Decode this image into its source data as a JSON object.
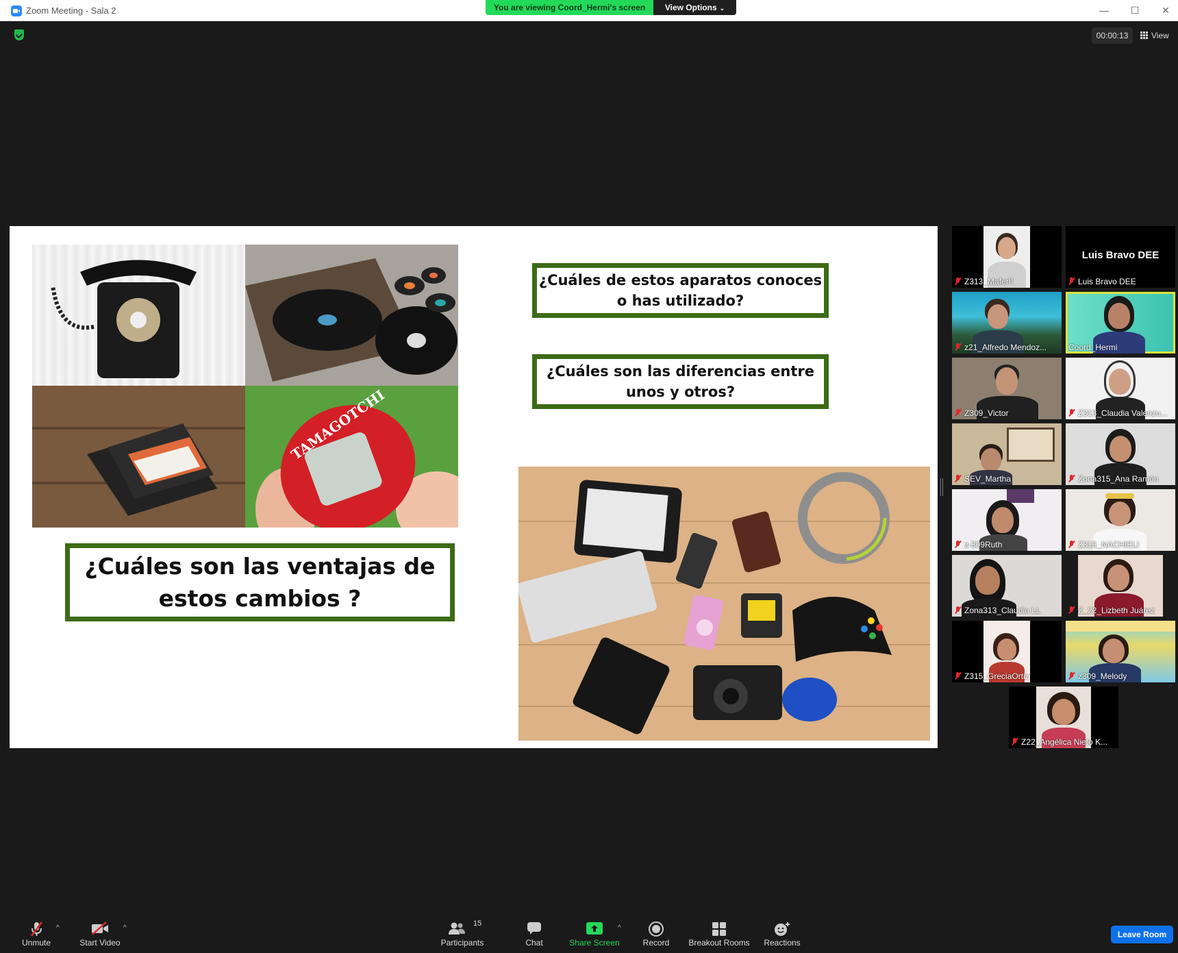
{
  "window": {
    "title": "Zoom Meeting - Sala 2",
    "minimize": "—",
    "maximize": "☐",
    "close": "✕"
  },
  "banner": {
    "viewing": "You are viewing Coord_Hermi's screen",
    "view_options": "View Options"
  },
  "top_right": {
    "timer": "00:00:13",
    "view_label": "View"
  },
  "slide": {
    "q_advantages": "¿Cuáles son las ventajas de estos cambios ?",
    "q_known_devices": "¿Cuáles de estos aparatos conoces o has utilizado?",
    "q_differences": "¿Cuáles son las diferencias entre unos y otros?",
    "tamagotchi_text": "TAMAGOTCHI"
  },
  "participants": [
    {
      "name": "Z313_Mafer!!"
    },
    {
      "name": "Luis Bravo DEE",
      "display": "Luis Bravo DEE"
    },
    {
      "name": "z21_Alfredo Mendoz..."
    },
    {
      "name": "Coord_Hermi"
    },
    {
      "name": "Z309_Victor"
    },
    {
      "name": "Z313_Claudia Valenzu..."
    },
    {
      "name": "SEV_Martha"
    },
    {
      "name": "Zona315_Ana Ramón"
    },
    {
      "name": "z-309Ruth"
    },
    {
      "name": "Z315_NACHIELI"
    },
    {
      "name": "Zona313_Claudia LL"
    },
    {
      "name": "Z_22_Lizbeth Juárez"
    },
    {
      "name": "Z315_GreciaOrtiz"
    },
    {
      "name": "z309_Melody"
    },
    {
      "name": "Z22_Angélica Nieto K..."
    }
  ],
  "toolbar": {
    "unmute": "Unmute",
    "start_video": "Start Video",
    "participants": "Participants",
    "participants_count": "15",
    "chat": "Chat",
    "share_screen": "Share Screen",
    "record": "Record",
    "breakout_rooms": "Breakout Rooms",
    "reactions": "Reactions",
    "leave": "Leave Room"
  },
  "colors": {
    "share_green": "#23d959",
    "leave_blue": "#0e71eb",
    "box_border": "#3c6b16",
    "active_speaker": "#d8e63d",
    "muted_red": "#e02828"
  }
}
